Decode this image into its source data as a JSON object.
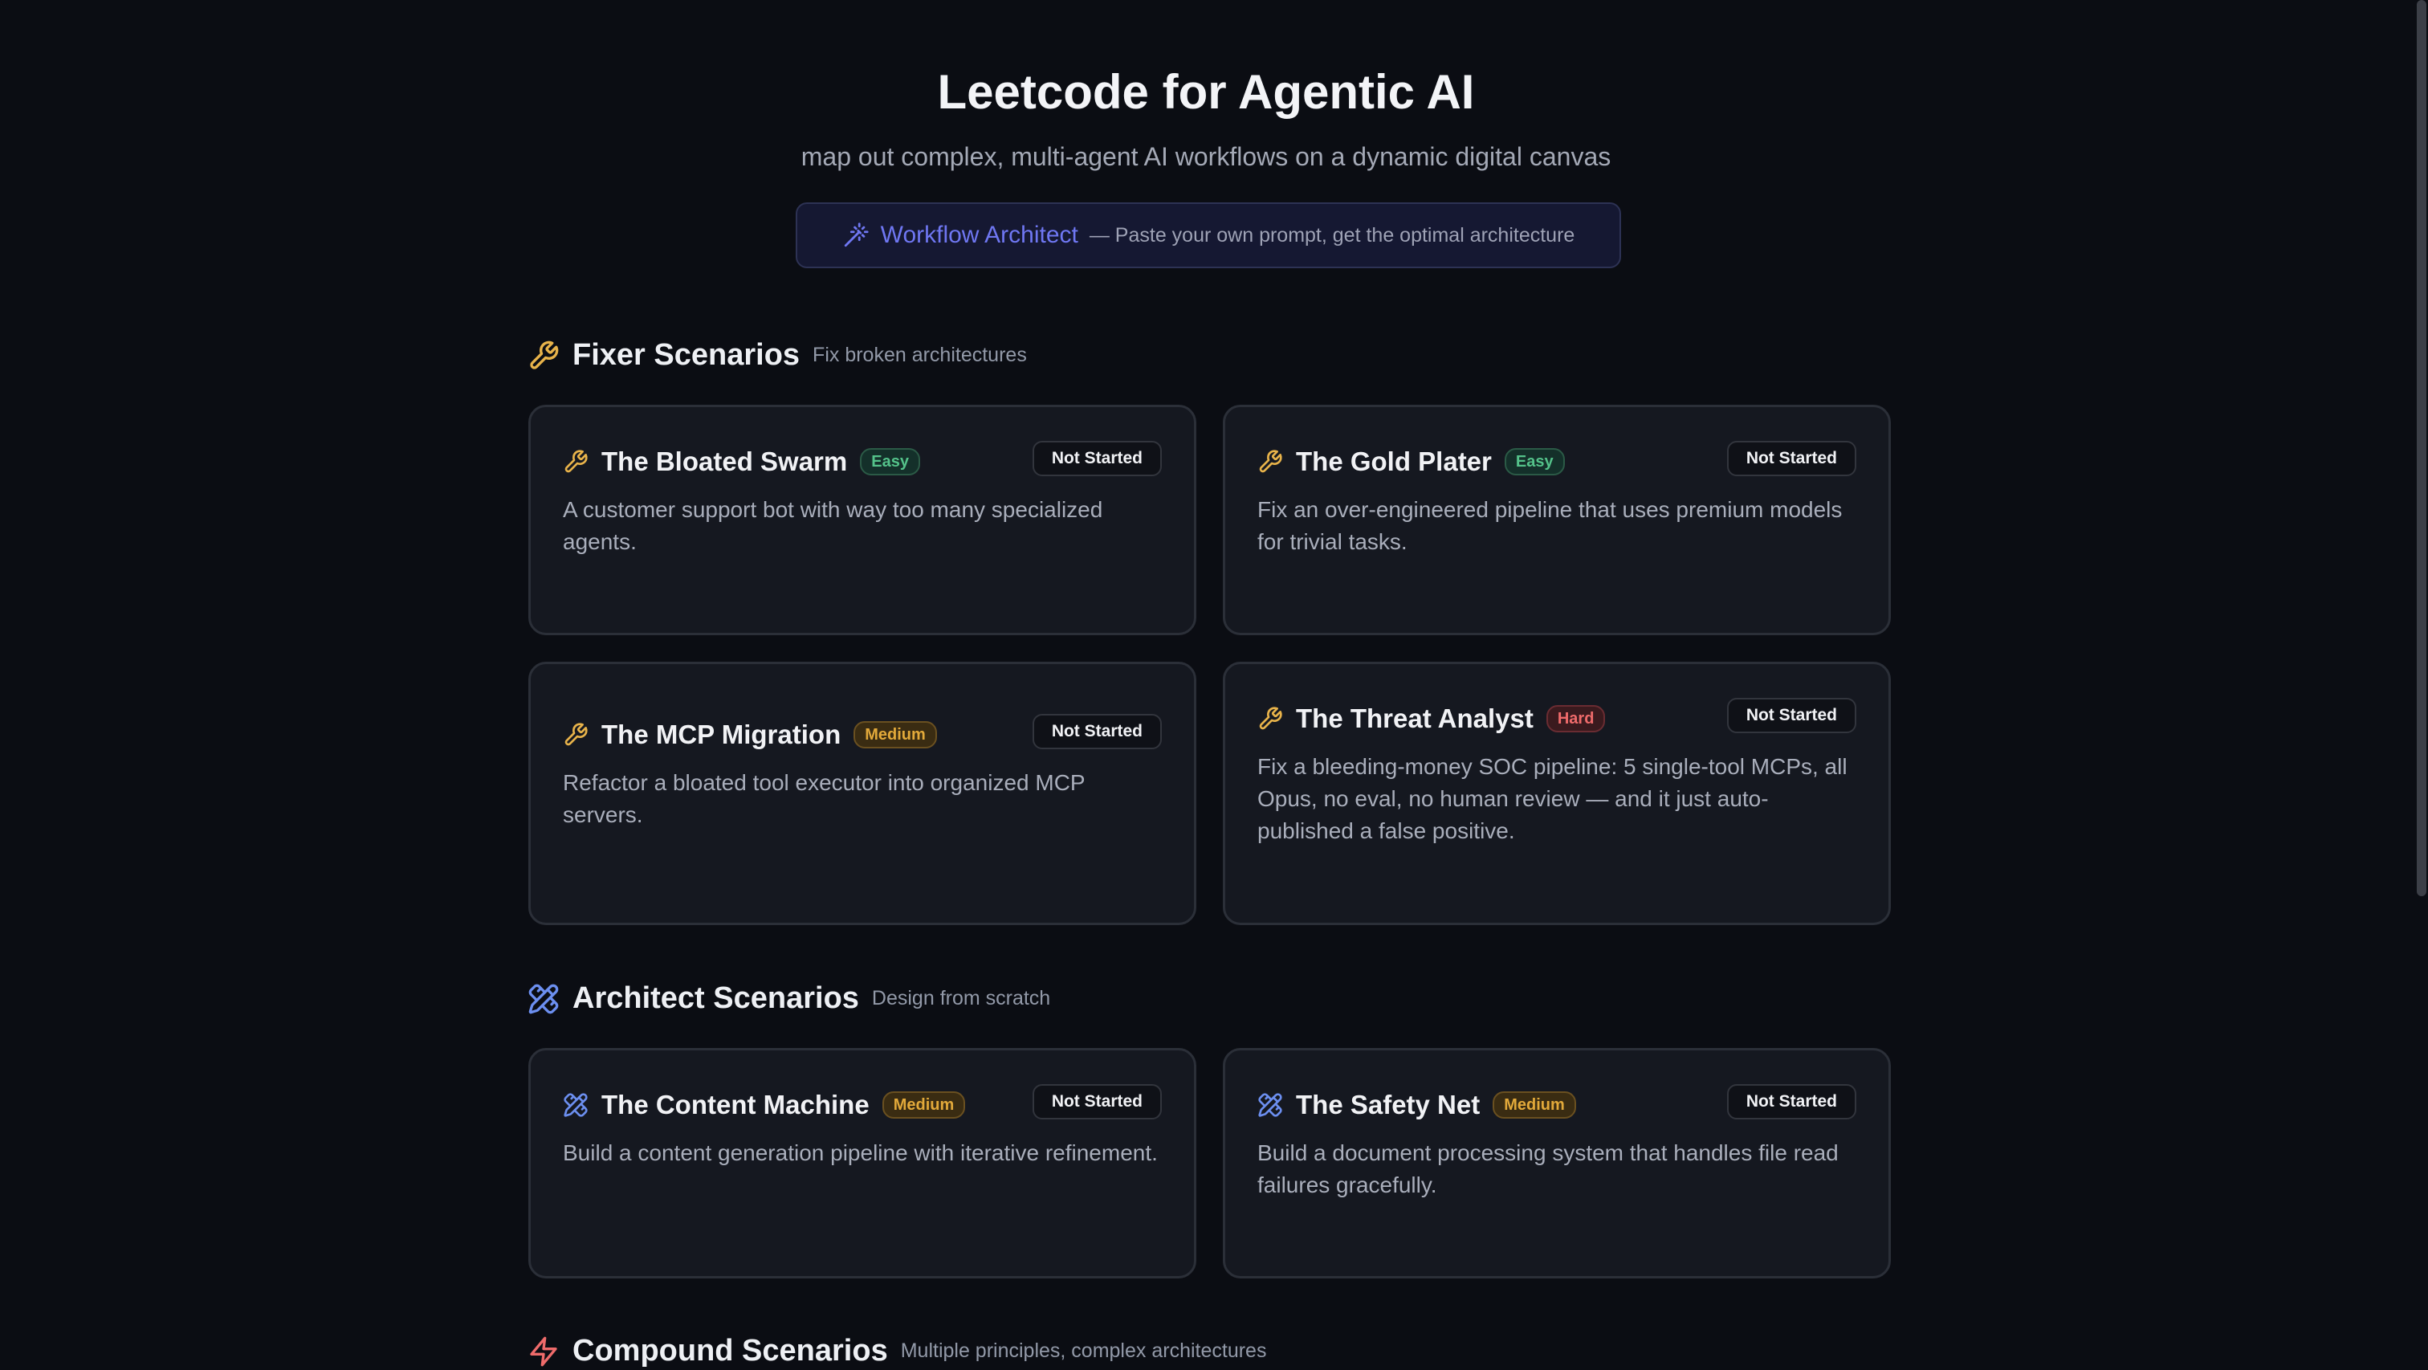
{
  "header": {
    "title": "Leetcode for Agentic AI",
    "subtitle": "map out complex, multi-agent AI workflows on a dynamic digital canvas"
  },
  "architect_button": {
    "label": "Workflow Architect",
    "description": "— Paste your own prompt, get the optimal architecture",
    "icon": "wand-icon",
    "accent": "#6f77f2"
  },
  "sections": [
    {
      "title": "Fixer Scenarios",
      "subtitle": "Fix broken architectures",
      "icon": "wrench-icon",
      "color": "#e8b34a",
      "cards": [
        {
          "title": "The Bloated Swarm",
          "difficulty": "Easy",
          "status": "Not Started",
          "description": "A customer support bot with way too many specialized agents."
        },
        {
          "title": "The Gold Plater",
          "difficulty": "Easy",
          "status": "Not Started",
          "description": "Fix an over-engineered pipeline that uses premium models for trivial tasks."
        },
        {
          "title": "The MCP Migration",
          "difficulty": "Medium",
          "status": "Not Started",
          "description": "Refactor a bloated tool executor into organized MCP servers."
        },
        {
          "title": "The Threat Analyst",
          "difficulty": "Hard",
          "status": "Not Started",
          "description": "Fix a bleeding-money SOC pipeline: 5 single-tool MCPs, all Opus, no eval, no human review — and it just auto-published a false positive."
        }
      ]
    },
    {
      "title": "Architect Scenarios",
      "subtitle": "Design from scratch",
      "icon": "pencil-ruler-icon",
      "color": "#6c8ff0",
      "cards": [
        {
          "title": "The Content Machine",
          "difficulty": "Medium",
          "status": "Not Started",
          "description": "Build a content generation pipeline with iterative refinement."
        },
        {
          "title": "The Safety Net",
          "difficulty": "Medium",
          "status": "Not Started",
          "description": "Build a document processing system that handles file read failures gracefully."
        }
      ]
    },
    {
      "title": "Compound Scenarios",
      "subtitle": "Multiple principles, complex architectures",
      "icon": "lightning-icon",
      "color": "#ef6b6b",
      "cards": []
    }
  ]
}
